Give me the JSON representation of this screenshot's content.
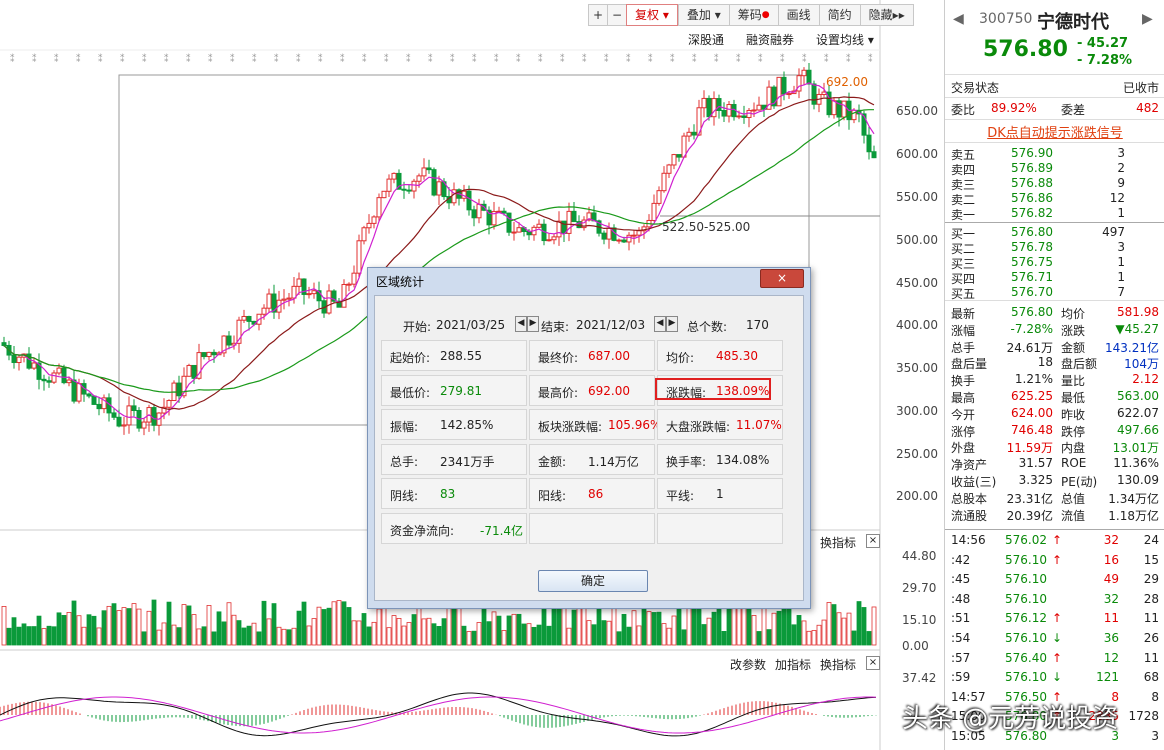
{
  "toolbar": {
    "plus": "+",
    "minus": "−",
    "fuquan": "复权",
    "fuquan_arrow": "▾",
    "diejia": "叠加",
    "diejia_arrow": "▾",
    "chouma": "筹码",
    "huaxian": "画线",
    "jianyue": "简约",
    "yincang": "隐藏",
    "more": "▸▸"
  },
  "subtoolbar": {
    "shengu": "深股通",
    "rongzi": "融资融券",
    "junxian": "设置均线"
  },
  "price_axis": [
    "650.00",
    "600.00",
    "550.00",
    "500.00",
    "450.00",
    "400.00",
    "350.00",
    "300.00",
    "250.00",
    "200.00"
  ],
  "annotations": {
    "high": "692.00",
    "low_range": "522.50-525.00"
  },
  "volume_axis": [
    "44.80",
    "29.70",
    "15.10",
    "0.00"
  ],
  "macd_axis": [
    "37.42"
  ],
  "panel_controls": {
    "huan_zhibiao": "换指标",
    "gai_canshu": "改参数",
    "jia_zhibiao": "加指标",
    "close": "×"
  },
  "stock": {
    "code": "300750",
    "name": "宁德时代",
    "price": "576.80",
    "change": "- 45.27",
    "change_pct": "- 7.28%"
  },
  "status": {
    "label": "交易状态",
    "value": "已收市"
  },
  "weibi": {
    "label": "委比",
    "value": "89.92%",
    "wc_label": "委差",
    "wc_value": "482"
  },
  "dk_link": "DK点自动提示涨跌信号",
  "asks": [
    {
      "label": "卖五",
      "price": "576.90",
      "vol": "3"
    },
    {
      "label": "卖四",
      "price": "576.89",
      "vol": "2"
    },
    {
      "label": "卖三",
      "price": "576.88",
      "vol": "9"
    },
    {
      "label": "卖二",
      "price": "576.86",
      "vol": "12"
    },
    {
      "label": "卖一",
      "price": "576.82",
      "vol": "1"
    }
  ],
  "bids": [
    {
      "label": "买一",
      "price": "576.80",
      "vol": "497"
    },
    {
      "label": "买二",
      "price": "576.78",
      "vol": "3"
    },
    {
      "label": "买三",
      "price": "576.75",
      "vol": "1"
    },
    {
      "label": "买四",
      "price": "576.71",
      "vol": "1"
    },
    {
      "label": "买五",
      "price": "576.70",
      "vol": "7"
    }
  ],
  "quote": [
    {
      "l1": "最新",
      "v1": "576.80",
      "c1": "green",
      "l2": "均价",
      "v2": "581.98",
      "c2": "red"
    },
    {
      "l1": "涨幅",
      "v1": "-7.28%",
      "c1": "green",
      "l2": "涨跌",
      "v2": "▼45.27",
      "c2": "green"
    },
    {
      "l1": "总手",
      "v1": "24.61万",
      "c1": "",
      "l2": "金额",
      "v2": "143.21亿",
      "c2": "blue"
    },
    {
      "l1": "盘后量",
      "v1": "18",
      "c1": "",
      "l2": "盘后额",
      "v2": "104万",
      "c2": "blue"
    },
    {
      "l1": "换手",
      "v1": "1.21%",
      "c1": "",
      "l2": "量比",
      "v2": "2.12",
      "c2": "red"
    },
    {
      "l1": "最高",
      "v1": "625.25",
      "c1": "red",
      "l2": "最低",
      "v2": "563.00",
      "c2": "green"
    },
    {
      "l1": "今开",
      "v1": "624.00",
      "c1": "red",
      "l2": "昨收",
      "v2": "622.07",
      "c2": ""
    },
    {
      "l1": "涨停",
      "v1": "746.48",
      "c1": "red",
      "l2": "跌停",
      "v2": "497.66",
      "c2": "green"
    },
    {
      "l1": "外盘",
      "v1": "11.59万",
      "c1": "red",
      "l2": "内盘",
      "v2": "13.01万",
      "c2": "green"
    },
    {
      "l1": "净资产",
      "v1": "31.57",
      "c1": "",
      "l2": "ROE",
      "v2": "11.36%",
      "c2": ""
    },
    {
      "l1": "收益(三)",
      "v1": "3.325",
      "c1": "",
      "l2": "PE(动)",
      "v2": "130.09",
      "c2": ""
    },
    {
      "l1": "总股本",
      "v1": "23.31亿",
      "c1": "",
      "l2": "总值",
      "v2": "1.34万亿",
      "c2": ""
    },
    {
      "l1": "流通股",
      "v1": "20.39亿",
      "c1": "",
      "l2": "流值",
      "v2": "1.18万亿",
      "c2": ""
    }
  ],
  "ticks": [
    {
      "t": "14:56",
      "p": "576.02",
      "a": "↑",
      "ac": "red",
      "v": "32",
      "vc": "red",
      "n": "24"
    },
    {
      "t": ":42",
      "p": "576.10",
      "a": "↑",
      "ac": "red",
      "v": "16",
      "vc": "red",
      "n": "15"
    },
    {
      "t": ":45",
      "p": "576.10",
      "a": "",
      "ac": "",
      "v": "49",
      "vc": "red",
      "n": "29"
    },
    {
      "t": ":48",
      "p": "576.10",
      "a": "",
      "ac": "",
      "v": "32",
      "vc": "green",
      "n": "28"
    },
    {
      "t": ":51",
      "p": "576.12",
      "a": "↑",
      "ac": "red",
      "v": "11",
      "vc": "red",
      "n": "11"
    },
    {
      "t": ":54",
      "p": "576.10",
      "a": "↓",
      "ac": "green",
      "v": "36",
      "vc": "green",
      "n": "26"
    },
    {
      "t": ":57",
      "p": "576.40",
      "a": "↑",
      "ac": "red",
      "v": "12",
      "vc": "green",
      "n": "11"
    },
    {
      "t": ":59",
      "p": "576.10",
      "a": "↓",
      "ac": "green",
      "v": "121",
      "vc": "green",
      "n": "68"
    },
    {
      "t": "14:57",
      "p": "576.50",
      "a": "↑",
      "ac": "red",
      "v": "8",
      "vc": "red",
      "n": "8"
    },
    {
      "t": "15:00",
      "p": "576.80",
      "a": "↑",
      "ac": "red",
      "v": "2835",
      "vc": "red",
      "n": "1728"
    },
    {
      "t": "15:05",
      "p": "576.80",
      "a": "",
      "ac": "",
      "v": "3",
      "vc": "green",
      "n": "3"
    }
  ],
  "dialog": {
    "title": "区域统计",
    "close": "×",
    "start_label": "开始:",
    "start": "2021/03/25",
    "end_label": "结束:",
    "end": "2021/12/03",
    "count_label": "总个数:",
    "count": "170",
    "cells": [
      {
        "l": "起始价:",
        "v": "288.55",
        "c": ""
      },
      {
        "l": "最终价:",
        "v": "687.00",
        "c": "red"
      },
      {
        "l": "均价:",
        "v": "485.30",
        "c": "red"
      },
      {
        "l": "最低价:",
        "v": "279.81",
        "c": "green"
      },
      {
        "l": "最高价:",
        "v": "692.00",
        "c": "red"
      },
      {
        "l": "涨跌幅:",
        "v": "138.09%",
        "c": "red"
      },
      {
        "l": "振幅:",
        "v": "142.85%",
        "c": ""
      },
      {
        "l": "板块涨跌幅:",
        "v": "105.96%",
        "c": "red"
      },
      {
        "l": "大盘涨跌幅:",
        "v": "11.07%",
        "c": "red"
      },
      {
        "l": "总手:",
        "v": "2341万手",
        "c": ""
      },
      {
        "l": "金额:",
        "v": "1.14万亿",
        "c": ""
      },
      {
        "l": "换手率:",
        "v": "134.08%",
        "c": ""
      },
      {
        "l": "阴线:",
        "v": "83",
        "c": "green"
      },
      {
        "l": "阳线:",
        "v": "86",
        "c": "red"
      },
      {
        "l": "平线:",
        "v": "1",
        "c": ""
      },
      {
        "l": "资金净流向:",
        "v": "-71.4亿",
        "c": "green"
      }
    ],
    "ok": "确定"
  },
  "watermark": "头条 @元芳说投资"
}
